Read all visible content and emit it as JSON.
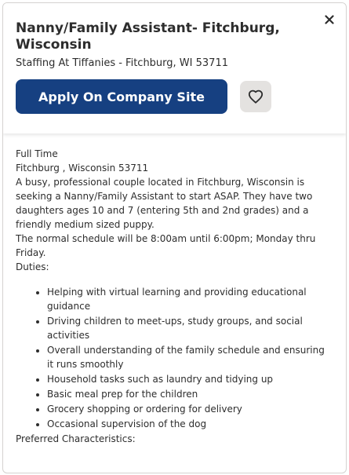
{
  "header": {
    "title": "Nanny/Family Assistant- Fitchburg, Wisconsin",
    "company_location": "Staffing At Tiffanies - Fitchburg, WI 53711",
    "apply_label": "Apply On Company Site"
  },
  "colors": {
    "apply_bg": "#164081",
    "save_bg": "#e4e2e0",
    "text": "#2d2d2d"
  },
  "description": {
    "job_type": "Full Time",
    "location": "Fitchburg , Wisconsin 53711",
    "intro": "A busy, professional couple located in Fitchburg, Wisconsin is seeking a Nanny/Family Assistant to start ASAP. They have two daughters ages 10 and 7 (entering 5th and 2nd grades) and a friendly medium sized puppy.",
    "schedule": "The normal schedule will be 8:00am until 6:00pm; Monday thru Friday.",
    "duties_heading": "Duties:",
    "duties": [
      "Helping with virtual learning and providing educational guidance",
      "Driving children to meet-ups, study groups, and social activities",
      "Overall understanding of the family schedule and ensuring it runs smoothly",
      "Household tasks such as laundry and tidying up",
      "Basic meal prep for the children",
      "Grocery shopping or ordering for delivery",
      "Occasional supervision of the dog"
    ],
    "preferred_heading": "Preferred Characteristics:"
  },
  "icons": {
    "close": "close-icon",
    "save": "heart-icon"
  }
}
